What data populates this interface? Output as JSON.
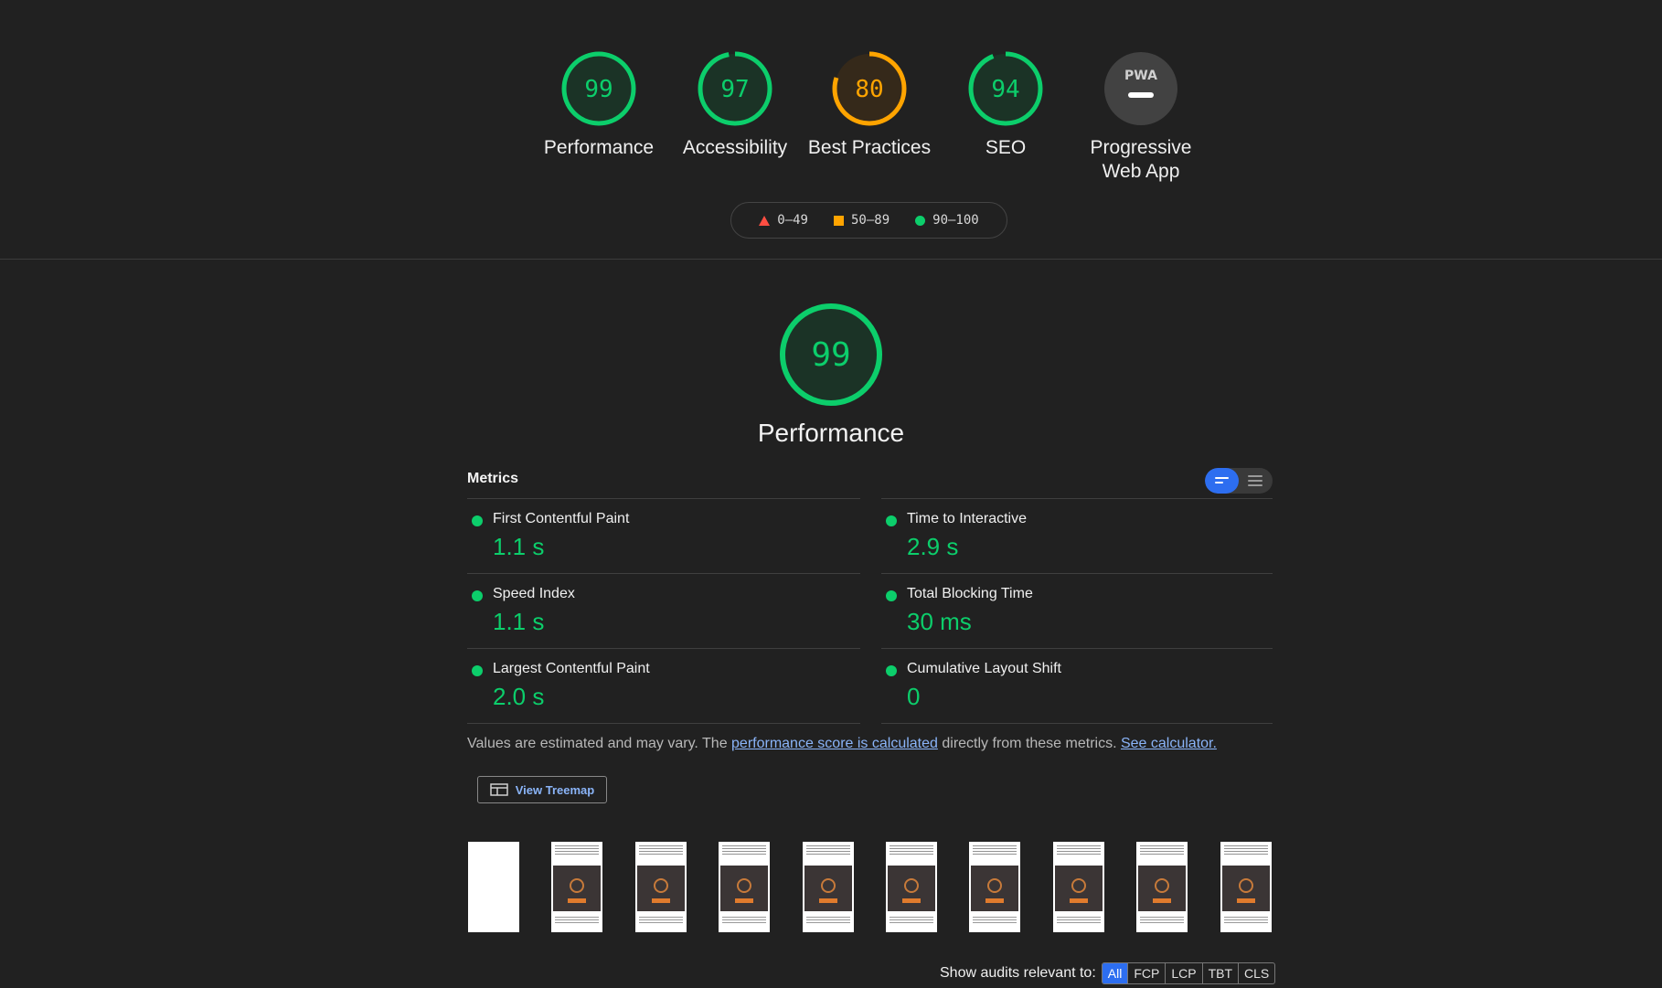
{
  "categories": [
    {
      "label": "Performance",
      "score": "99",
      "status": "pass"
    },
    {
      "label": "Accessibility",
      "score": "97",
      "status": "pass"
    },
    {
      "label": "Best Practices",
      "score": "80",
      "status": "average"
    },
    {
      "label": "SEO",
      "score": "94",
      "status": "pass"
    },
    {
      "label": "Progressive\nWeb App",
      "badge": "PWA",
      "status": "na"
    }
  ],
  "legend": {
    "fail": "0–49",
    "average": "50–89",
    "pass": "90–100"
  },
  "colors": {
    "pass": "#0cce6b",
    "average": "#ffa400",
    "fail": "#ff4e42",
    "accent": "#2d6ef0",
    "link": "#8ab4f8"
  },
  "performance": {
    "score": "99",
    "title": "Performance"
  },
  "metrics": {
    "title": "Metrics",
    "left": [
      {
        "name": "First Contentful Paint",
        "value": "1.1 s"
      },
      {
        "name": "Speed Index",
        "value": "1.1 s"
      },
      {
        "name": "Largest Contentful Paint",
        "value": "2.0 s"
      }
    ],
    "right": [
      {
        "name": "Time to Interactive",
        "value": "2.9 s"
      },
      {
        "name": "Total Blocking Time",
        "value": "30 ms"
      },
      {
        "name": "Cumulative Layout Shift",
        "value": "0"
      }
    ]
  },
  "note": {
    "prefix": "Values are estimated and may vary. The ",
    "link1": "performance score is calculated",
    "middle": " directly from these metrics. ",
    "link2": "See calculator."
  },
  "treemap_button": "View Treemap",
  "audits_filter": {
    "label": "Show audits relevant to:",
    "options": [
      "All",
      "FCP",
      "LCP",
      "TBT",
      "CLS"
    ],
    "selected": "All"
  }
}
